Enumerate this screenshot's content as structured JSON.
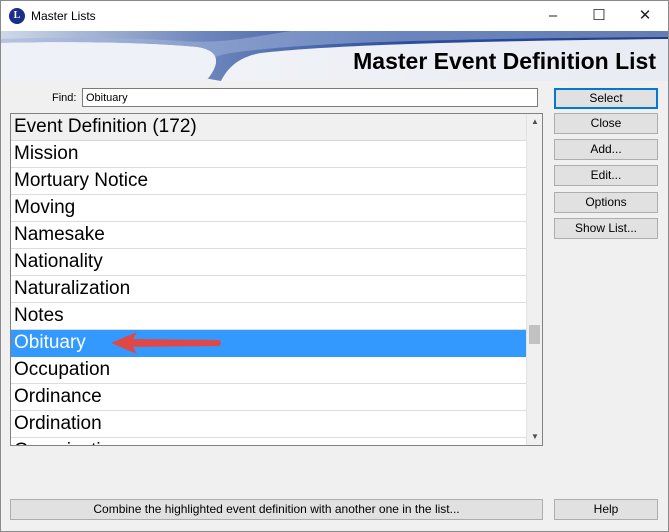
{
  "window": {
    "title": "Master Lists",
    "app_icon": "L",
    "controls": {
      "minimize": "–",
      "maximize": "☐",
      "close": "✕"
    }
  },
  "banner": {
    "title": "Master Event Definition List"
  },
  "find": {
    "label": "Find:",
    "value": "Obituary"
  },
  "list": {
    "header": "Event Definition (172)",
    "items": [
      "Mission",
      "Mortuary Notice",
      "Moving",
      "Namesake",
      "Nationality",
      "Naturalization",
      "Notes",
      "Obituary",
      "Occupation",
      "Ordinance",
      "Ordination",
      "Organization"
    ],
    "selected": "Obituary",
    "scroll_up_glyph": "▲",
    "scroll_down_glyph": "▼"
  },
  "buttons": {
    "select": "Select",
    "close": "Close",
    "add": "Add...",
    "edit": "Edit...",
    "options": "Options",
    "show_list": "Show List...",
    "combine": "Combine the highlighted event definition with another one in the list...",
    "help": "Help"
  },
  "colors": {
    "selection": "#3399ff",
    "annotation_arrow": "#e04848",
    "banner_blue": "#2c4f9e"
  },
  "icons": {
    "annotation": "red-arrow-left-icon"
  }
}
